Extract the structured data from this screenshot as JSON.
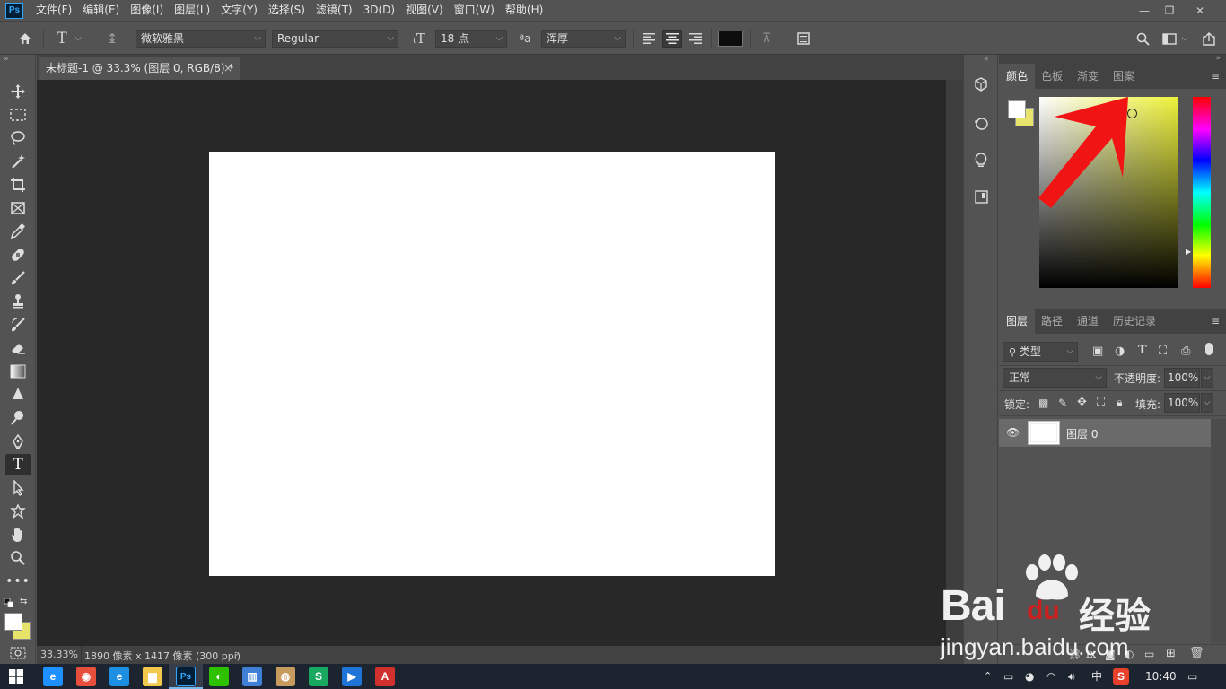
{
  "app": {
    "logo": "Ps"
  },
  "menu": [
    "文件(F)",
    "编辑(E)",
    "图像(I)",
    "图层(L)",
    "文字(Y)",
    "选择(S)",
    "滤镜(T)",
    "3D(D)",
    "视图(V)",
    "窗口(W)",
    "帮助(H)"
  ],
  "window_controls": {
    "minimize": "—",
    "restore": "❐",
    "close": "✕"
  },
  "options": {
    "font_family": "微软雅黑",
    "font_style": "Regular",
    "font_size": "18 点",
    "aa_label": "ªa",
    "antialias": "浑厚"
  },
  "document": {
    "tab_title": "未标题-1 @ 33.3% (图层 0, RGB/8) *",
    "tab_close": "×",
    "zoom": "33.33%",
    "size_info": "1890 像素 x 1417 像素 (300 ppi)",
    "status_arrow": "›"
  },
  "color_panel": {
    "tabs": [
      "颜色",
      "色板",
      "渐变",
      "图案"
    ],
    "active_tab": "颜色",
    "foreground": "#ffffff",
    "background": "#e8e36a",
    "picker_hue": "#eef23a"
  },
  "layers_panel": {
    "tabs": [
      "图层",
      "路径",
      "通道",
      "历史记录"
    ],
    "active_tab": "图层",
    "filter_label": "类型",
    "blend_mode": "正常",
    "opacity_label": "不透明度:",
    "opacity_value": "100%",
    "lock_label": "锁定:",
    "fill_label": "填充:",
    "fill_value": "100%",
    "layers": [
      {
        "name": "图层 0",
        "visible": true
      }
    ]
  },
  "taskbar": {
    "time": "10:40",
    "ime": "中",
    "apps": [
      {
        "name": "ie-icon",
        "glyph": "e",
        "color": "#1e90ff"
      },
      {
        "name": "chrome-icon",
        "glyph": "◉",
        "color": "#e84e3c"
      },
      {
        "name": "edge-icon",
        "glyph": "e",
        "color": "#1c8fe3"
      },
      {
        "name": "folder-icon",
        "glyph": "▆",
        "color": "#f2c94c"
      },
      {
        "name": "photoshop-icon",
        "glyph": "Ps",
        "color": "#001e36"
      },
      {
        "name": "wechat-icon",
        "glyph": "◐",
        "color": "#2dc100"
      },
      {
        "name": "app-bars-icon",
        "glyph": "▥",
        "color": "#3f7fd6"
      },
      {
        "name": "app-sphere-icon",
        "glyph": "◍",
        "color": "#c79a5e"
      },
      {
        "name": "wps-sheets-icon",
        "glyph": "S",
        "color": "#19a85f"
      },
      {
        "name": "player-icon",
        "glyph": "▶",
        "color": "#1f74d8"
      },
      {
        "name": "acrobat-icon",
        "glyph": "A",
        "color": "#d0312d"
      }
    ]
  },
  "watermark": {
    "brand": "Bai",
    "brand2": "du",
    "suffix": "经验",
    "url": "jingyan.baidu.com"
  }
}
